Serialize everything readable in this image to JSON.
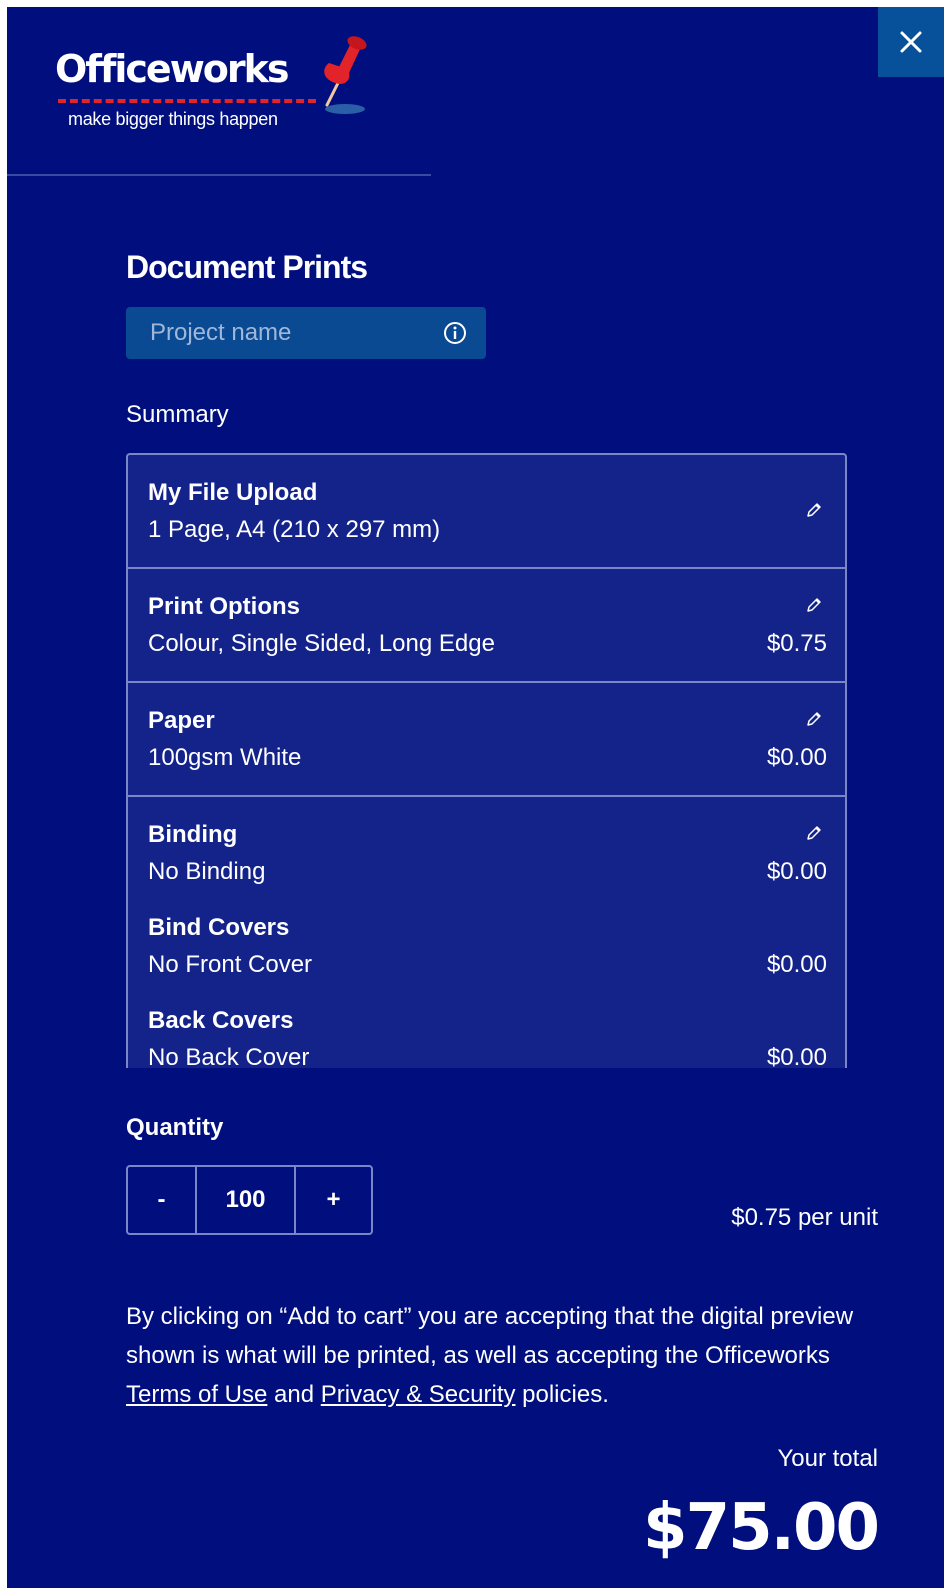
{
  "header": {
    "logo_text": "Officeworks",
    "logo_tagline": "make bigger things happen"
  },
  "page_title": "Document Prints",
  "project_name": {
    "placeholder": "Project name",
    "value": ""
  },
  "summary": {
    "label": "Summary",
    "file_upload": {
      "title": "My File Upload",
      "desc": "1 Page, A4 (210 x 297 mm)"
    },
    "print_options": {
      "title": "Print Options",
      "desc": "Colour, Single Sided, Long Edge",
      "price": "$0.75"
    },
    "paper": {
      "title": "Paper",
      "desc": "100gsm White",
      "price": "$0.00"
    },
    "binding": {
      "title": "Binding",
      "desc": "No Binding",
      "price": "$0.00",
      "bind_covers": {
        "title": "Bind Covers",
        "desc": "No Front Cover",
        "price": "$0.00"
      },
      "back_covers": {
        "title": "Back Covers",
        "desc": "No Back Cover",
        "price": "$0.00"
      }
    }
  },
  "quantity": {
    "label": "Quantity",
    "minus": "-",
    "value": "100",
    "plus": "+",
    "per_unit": "$0.75 per unit"
  },
  "disclaimer": {
    "prefix": "By clicking on “Add to cart” you are accepting that the digital preview shown is what will be printed, as well as accepting the Officeworks ",
    "terms_link": "Terms of Use",
    "middle": " and ",
    "privacy_link": "Privacy & Security",
    "suffix": " policies."
  },
  "total": {
    "label": "Your total",
    "amount": "$75.00"
  },
  "colors": {
    "panel_bg": "#000f7d",
    "accent_red": "#e2232a",
    "close_bg": "#07509a"
  }
}
